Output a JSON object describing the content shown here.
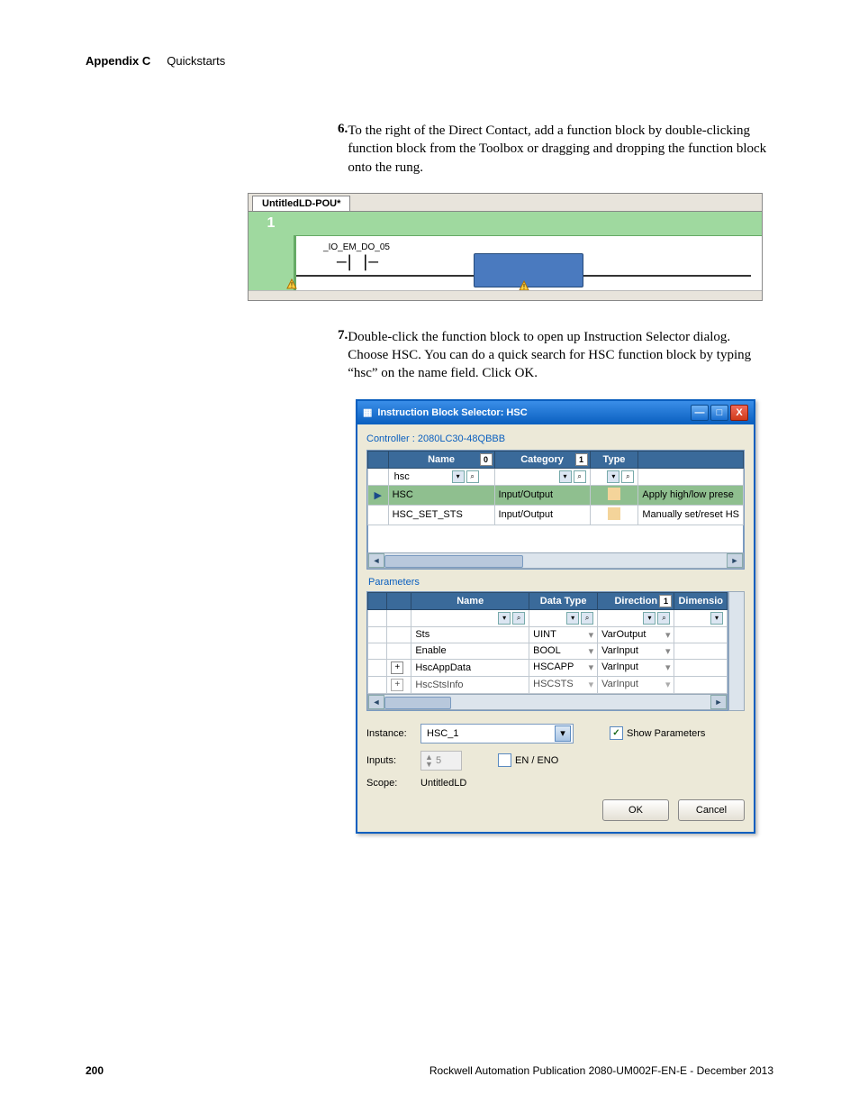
{
  "header": {
    "section": "Appendix C",
    "title": "Quickstarts"
  },
  "steps": {
    "s6": {
      "num": "6.",
      "text": "To the right of the Direct Contact, add a function block by double-clicking function block from the Toolbox or dragging and dropping the function block onto the rung."
    },
    "s7": {
      "num": "7.",
      "text": "Double-click the function block to open up Instruction Selector dialog. Choose HSC.  You can do a quick search for HSC function block by typing “hsc” on the name field. Click OK."
    }
  },
  "ladder": {
    "tab": "UntitledLD-POU*",
    "rung_num": "1",
    "contact_label": "_IO_EM_DO_05"
  },
  "dialog": {
    "title": "Instruction Block Selector: HSC",
    "controller": "Controller : 2080LC30-48QBBB",
    "grid1": {
      "headers": {
        "name": "Name",
        "category": "Category",
        "type": "Type",
        "desc": ""
      },
      "sort0": "0",
      "sort1": "1",
      "filter_name": "hsc",
      "rows": [
        {
          "name": "HSC",
          "category": "Input/Output",
          "type_icon": true,
          "desc": "Apply high/low prese",
          "selected": true
        },
        {
          "name": "HSC_SET_STS",
          "category": "Input/Output",
          "type_icon": true,
          "desc": "Manually set/reset HS",
          "selected": false
        }
      ]
    },
    "params_label": "Parameters",
    "grid2": {
      "headers": {
        "name": "Name",
        "datatype": "Data Type",
        "direction": "Direction",
        "dimension": "Dimensio"
      },
      "sort1": "1",
      "rows": [
        {
          "name": "Sts",
          "datatype": "UINT",
          "direction": "VarOutput"
        },
        {
          "name": "Enable",
          "datatype": "BOOL",
          "direction": "VarInput"
        },
        {
          "name": "HscAppData",
          "datatype": "HSCAPP",
          "direction": "VarInput",
          "expand": "+"
        },
        {
          "name": "HscStsInfo",
          "datatype": "HSCSTS",
          "direction": "VarInput",
          "expand": "+"
        }
      ]
    },
    "form": {
      "instance_lbl": "Instance:",
      "instance_val": "HSC_1",
      "inputs_lbl": "Inputs:",
      "inputs_val": "5",
      "scope_lbl": "Scope:",
      "scope_val": "UntitledLD",
      "show_params": "Show Parameters",
      "en_eno": "EN / ENO"
    },
    "buttons": {
      "ok": "OK",
      "cancel": "Cancel"
    }
  },
  "footer": {
    "page": "200",
    "pub": "Rockwell Automation Publication 2080-UM002F-EN-E - December 2013"
  }
}
